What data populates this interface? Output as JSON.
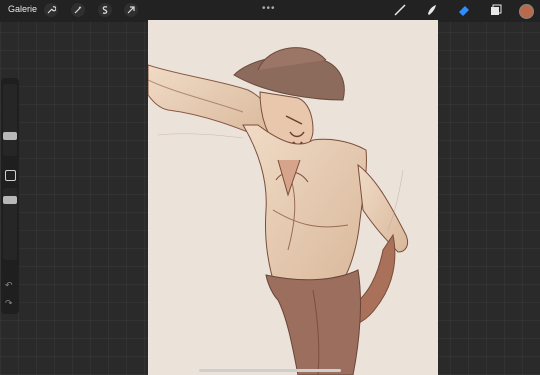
{
  "topbar": {
    "gallery_label": "Galerie",
    "left_tools": [
      "wrench-icon",
      "magic-wand-icon",
      "selection-icon",
      "transform-arrow-icon"
    ],
    "right_tools": [
      "brush-icon",
      "smudge-icon",
      "eraser-icon",
      "layers-icon"
    ],
    "active_color": "#b86a4b",
    "eraser_active_color": "#2f8cff"
  },
  "sidebar": {
    "brush_size_level": 0.45,
    "opacity_level": 0.65
  },
  "canvas": {
    "background": "#ebe3da",
    "subject": "sketch-figure-cowboy"
  }
}
